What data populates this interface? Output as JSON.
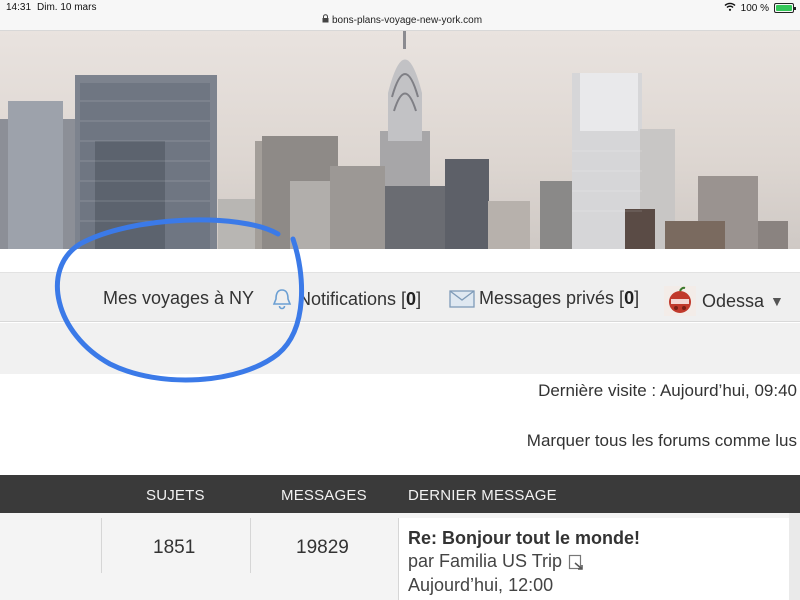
{
  "status_bar": {
    "time": "14:31",
    "date": "Dim. 10 mars",
    "url": "bons-plans-voyage-new-york.com",
    "battery": "100 %",
    "battery_level": 1.0
  },
  "nav": {
    "my_trips": "Mes voyages à NY",
    "notifications_label": "Notifications [",
    "notifications_count": "0",
    "messages_label": "Messages privés [",
    "messages_count": "0",
    "bracket_close": "]",
    "username": "Odessa",
    "user_menu_caret": "▼"
  },
  "info": {
    "last_visit": "Dernière visite : Aujourd’hui, 09:40",
    "mark_all_read": "Marquer tous les forums comme lus"
  },
  "table": {
    "headers": [
      "SUJETS",
      "MESSAGES",
      "DERNIER MESSAGE"
    ],
    "row": {
      "topics": "1851",
      "posts": "19829",
      "last_title": "Re: Bonjour tout le monde!",
      "last_by": "par Familia US Trip",
      "last_date": "Aujourd’hui, 12:00"
    }
  },
  "colors": {
    "annotation_circle": "#3b7ae8",
    "table_header_bg": "#3a3a3a",
    "nav_bg": "#efefef"
  }
}
